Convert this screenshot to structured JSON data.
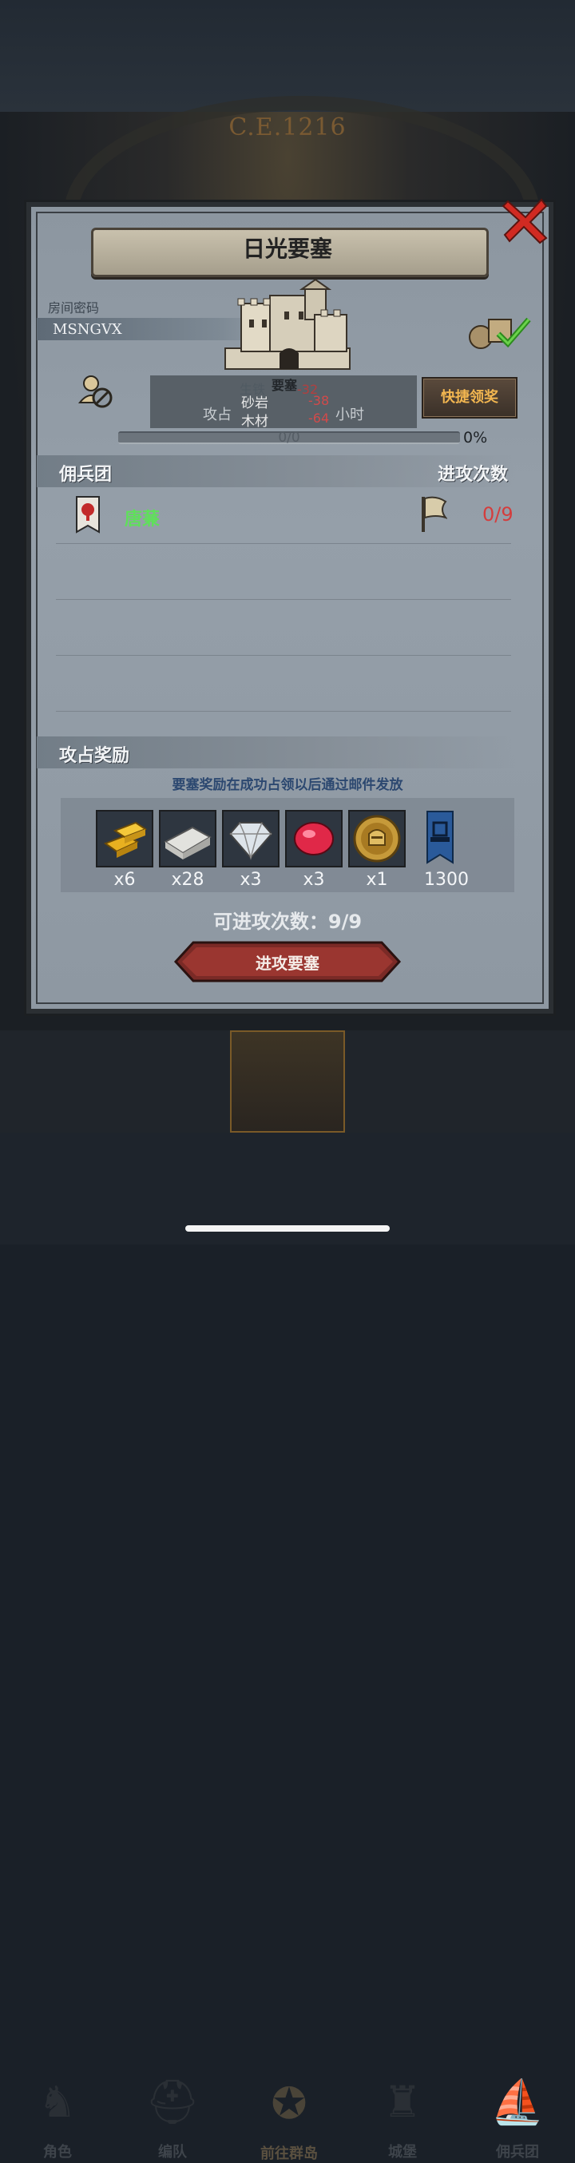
{
  "scene": {
    "year": "C.E.1216"
  },
  "dialog": {
    "title": "日光要塞",
    "room_label": "房间密码",
    "room_code": "MSNGVX",
    "fortress_tag": "要塞",
    "ghost_resource": "生铁",
    "ghost_value": "-32",
    "resources": [
      {
        "name": "砂岩",
        "value": "-38"
      },
      {
        "name": "木材",
        "value": "-64"
      }
    ],
    "occupy_text": "攻占",
    "occupy_suffix": "小时",
    "quick_claim": "快捷领奖",
    "progress_text": "0/0",
    "progress_percent": "0%",
    "progress_fraction": 0,
    "mercenary_header": "佣兵团",
    "attack_count_header": "进攻次数",
    "mercenary": {
      "name": "唐蒹",
      "count": "0/9"
    },
    "reward_header": "攻占奖励",
    "reward_notice": "要塞奖励在成功占领以后通过邮件发放",
    "rewards": [
      {
        "icon": "gold-bars-icon",
        "count": "x6"
      },
      {
        "icon": "silver-bar-icon",
        "count": "x28"
      },
      {
        "icon": "diamond-icon",
        "count": "x3"
      },
      {
        "icon": "ruby-icon",
        "count": "x3"
      },
      {
        "icon": "knight-coin-icon",
        "count": "x1"
      },
      {
        "icon": "blue-banner-icon",
        "count": "1300"
      }
    ],
    "attacks_available": "可进攻次数：9/9",
    "attack_button": "进攻要塞"
  },
  "nav": [
    {
      "label": "角色",
      "icon": "knight-icon"
    },
    {
      "label": "编队",
      "icon": "helmet-icon"
    },
    {
      "label": "前往群岛",
      "icon": "compass-icon"
    },
    {
      "label": "城堡",
      "icon": "castle-icon"
    },
    {
      "label": "佣兵团",
      "icon": "ship-icon"
    }
  ],
  "colors": {
    "accent_gold": "#f2b650",
    "negative": "#d24a4a",
    "merc_green": "#5fe05a",
    "notice_blue": "#2c4870"
  }
}
